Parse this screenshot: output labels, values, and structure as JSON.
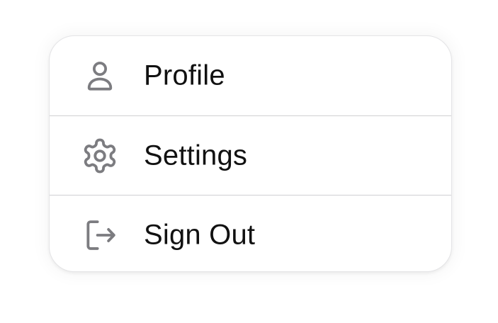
{
  "menu": {
    "items": [
      {
        "id": "profile",
        "label": "Profile",
        "icon": "person-icon"
      },
      {
        "id": "settings",
        "label": "Settings",
        "icon": "gear-icon"
      },
      {
        "id": "sign-out",
        "label": "Sign Out",
        "icon": "sign-out-icon"
      }
    ]
  },
  "colors": {
    "icon": "#7c7c80",
    "text": "#111111",
    "divider": "#cfcfd2",
    "border": "#e4e4e6",
    "background": "#ffffff"
  }
}
